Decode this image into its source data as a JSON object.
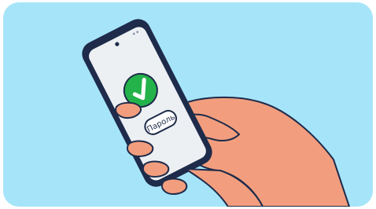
{
  "illustration": {
    "background_color": "#A6E4FA",
    "skin_color": "#F29E7E",
    "phone_body_color": "#1E2B4A",
    "screen_color": "#EDF0F3",
    "check_color": "#24B34A",
    "icon": "checkmark-icon",
    "button_label": "Пароль"
  }
}
